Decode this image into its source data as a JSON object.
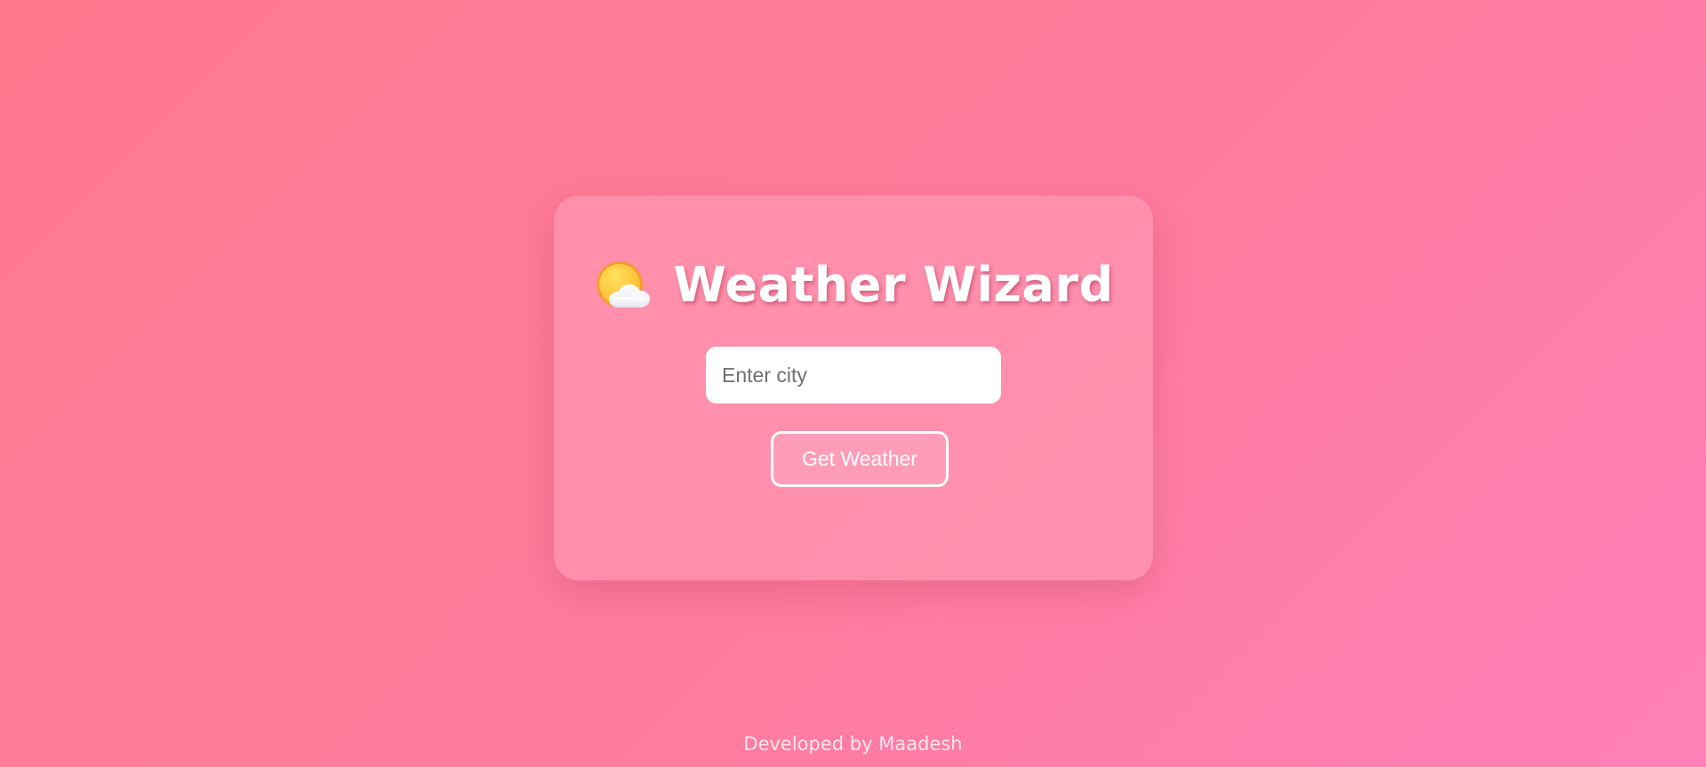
{
  "app": {
    "title": "Weather Wizard",
    "icon": "sun-behind-cloud-icon"
  },
  "search": {
    "placeholder": "Enter city",
    "value": "",
    "button_label": "Get Weather"
  },
  "footer": {
    "text": "Developed by Maadesh"
  },
  "colors": {
    "background_start": "#ff7a8e",
    "background_end": "#ff80b8",
    "card": "#ff9ab4",
    "text": "#ffffff"
  }
}
